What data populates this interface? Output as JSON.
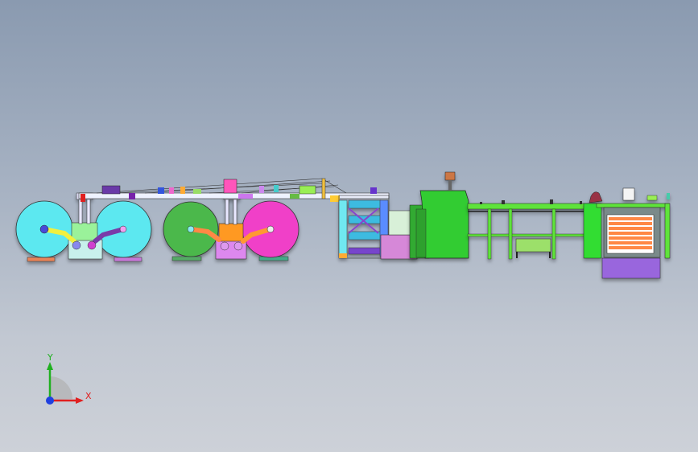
{
  "viewport": {
    "background_top": "#8a9ab0",
    "background_bottom": "#cdd1d8"
  },
  "machine": {
    "unwinders": [
      {
        "color": "#5ce8f0"
      },
      {
        "color": "#5ce8f0"
      },
      {
        "color": "#4bb84b"
      },
      {
        "color": "#f040c8"
      }
    ],
    "main_body_color": "#33cc33",
    "frame_color": "#5fe33a",
    "output_bin_color": "#9966dd"
  },
  "triad": {
    "x_label": "X",
    "y_label": "Y",
    "x_color": "#e02020",
    "y_color": "#20b020",
    "z_color": "#2040e0"
  }
}
